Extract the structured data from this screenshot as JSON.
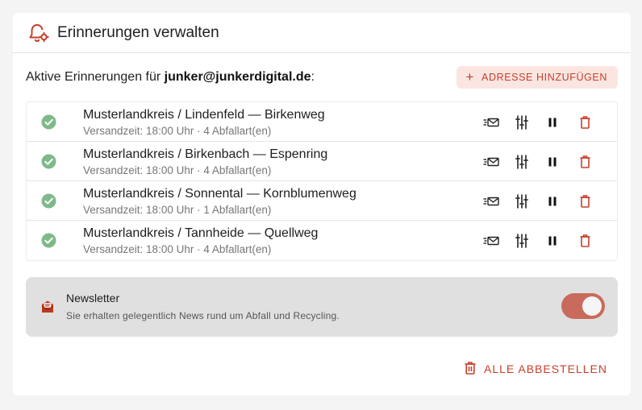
{
  "header": {
    "title": "Erinnerungen verwalten",
    "icon": "bell-gear-icon"
  },
  "active": {
    "prefix": "Aktive Erinnerungen für ",
    "email": "junker@junkerdigital.de",
    "suffix": ":"
  },
  "add_button": {
    "plus": "+",
    "label": "ADRESSE HINZUFÜGEN"
  },
  "reminders": [
    {
      "title": "Musterlandkreis / Lindenfeld — Birkenweg",
      "subtitle": "Versandzeit: 18:00 Uhr · 4 Abfallart(en)"
    },
    {
      "title": "Musterlandkreis / Birkenbach — Espenring",
      "subtitle": "Versandzeit: 18:00 Uhr · 4 Abfallart(en)"
    },
    {
      "title": "Musterlandkreis / Sonnental — Kornblumenweg",
      "subtitle": "Versandzeit: 18:00 Uhr · 1 Abfallart(en)"
    },
    {
      "title": "Musterlandkreis / Tannheide — Quellweg",
      "subtitle": "Versandzeit: 18:00 Uhr · 4 Abfallart(en)"
    }
  ],
  "newsletter": {
    "title": "Newsletter",
    "description": "Sie erhalten gelegentlich News rund um Abfall und Recycling.",
    "enabled": true
  },
  "unsubscribe_all": {
    "label": "ALLE ABBESTELLEN"
  },
  "colors": {
    "accent": "#c6402b",
    "check": "#7fb98a",
    "toggle": "#c96b5c",
    "newsletter_bg": "#e0e0e0"
  }
}
